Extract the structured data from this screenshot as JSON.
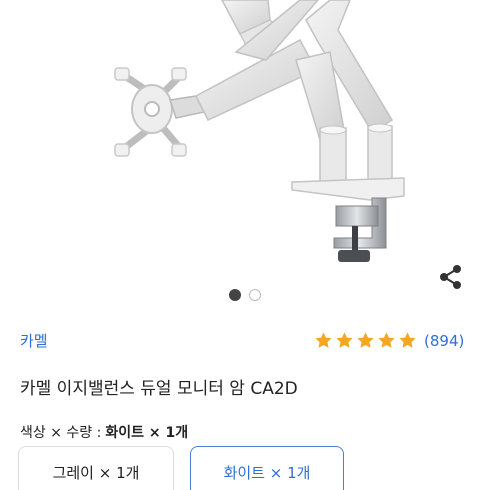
{
  "product": {
    "brand": "카멜",
    "title": "카멜 이지밸런스 듀얼 모니터 암 CA2D",
    "rating": {
      "stars": 5,
      "count_text": "(894)",
      "star_color": "#f5a623"
    },
    "selection": {
      "label": "색상 × 수량 :",
      "value": "화이트 × 1개"
    },
    "options": [
      {
        "label": "그레이 × 1개",
        "selected": false
      },
      {
        "label": "화이트 × 1개",
        "selected": true
      }
    ],
    "gallery": {
      "current": 1,
      "total": 2
    }
  },
  "icons": {
    "share": "share-icon",
    "star": "star-icon"
  },
  "colors": {
    "accent": "#2f6fd6",
    "selected_border": "#4a7fd8",
    "dot_active": "#444444"
  }
}
